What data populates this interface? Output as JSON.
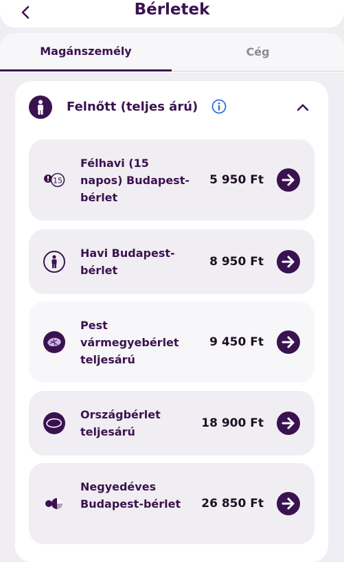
{
  "header": {
    "back_icon": "chevron-left-icon",
    "title": "Bérletek"
  },
  "tabs": [
    {
      "label": "Magánszemély",
      "active": true
    },
    {
      "label": "Cég",
      "active": false
    }
  ],
  "section": {
    "icon": "person-icon",
    "title": "Felnőtt (teljes árú)",
    "info_icon": "info-icon",
    "collapse_icon": "chevron-up-icon"
  },
  "passes": [
    {
      "icon": "fifteen-day-icon",
      "icon_text": "15",
      "name": "Félhavi (15 napos) Budapest-bérlet",
      "price": "5 950 Ft"
    },
    {
      "icon": "person-icon",
      "name": "Havi Budapest-bérlet",
      "price": "8 950 Ft"
    },
    {
      "icon": "county-map-icon",
      "name": "Pest vármegyebérlet teljesárú",
      "price": "9 450 Ft",
      "highlighted": true
    },
    {
      "icon": "country-map-icon",
      "name": "Országbérlet teljesárú",
      "price": "18 900 Ft"
    },
    {
      "icon": "quarterly-icon",
      "name": "Negyedéves Budapest-bérlet",
      "price": "26 850 Ft"
    }
  ],
  "colors": {
    "brand": "#3b1250",
    "background": "#f0eef2",
    "highlight": "#f5d23a",
    "info": "#2a6fd6"
  }
}
